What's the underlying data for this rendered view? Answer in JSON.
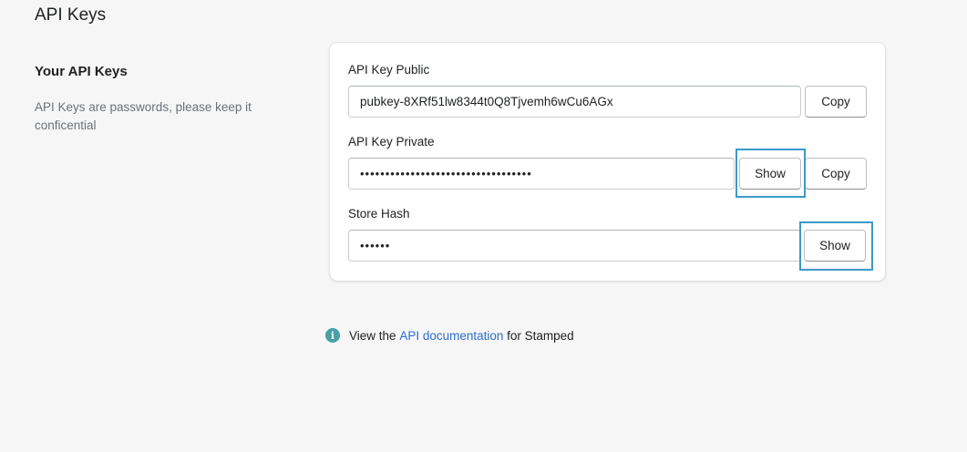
{
  "page": {
    "title": "API Keys"
  },
  "section": {
    "title": "Your API Keys",
    "description": "API Keys are passwords, please keep it conficential"
  },
  "fields": {
    "public": {
      "label": "API Key Public",
      "value": "pubkey-8XRf51lw8344t0Q8Tjvemh6wCu6AGx",
      "copy_label": "Copy"
    },
    "private": {
      "label": "API Key Private",
      "value": "••••••••••••••••••••••••••••••••••",
      "show_label": "Show",
      "copy_label": "Copy"
    },
    "store_hash": {
      "label": "Store Hash",
      "value": "••••••",
      "show_label": "Show"
    }
  },
  "footer": {
    "icon": "info-icon",
    "prefix": "View the",
    "link_text": "API documentation",
    "suffix": "for Stamped"
  },
  "colors": {
    "highlight": "#3b9ac8",
    "link": "#2c6ecb",
    "info_icon": "#47a0a8"
  }
}
